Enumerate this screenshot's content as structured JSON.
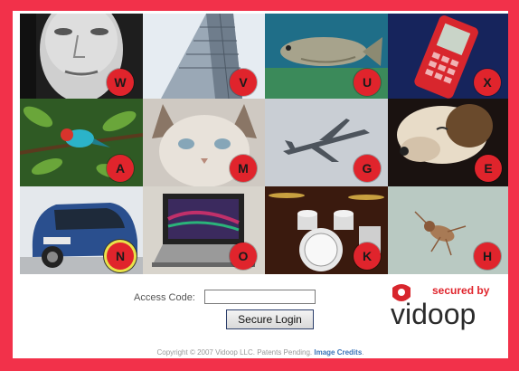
{
  "tiles": [
    {
      "letter": "W",
      "subject": "man-face"
    },
    {
      "letter": "V",
      "subject": "skyscraper"
    },
    {
      "letter": "U",
      "subject": "fish"
    },
    {
      "letter": "X",
      "subject": "red-phone"
    },
    {
      "letter": "A",
      "subject": "bird"
    },
    {
      "letter": "M",
      "subject": "cat"
    },
    {
      "letter": "G",
      "subject": "fighter-jet"
    },
    {
      "letter": "E",
      "subject": "dog"
    },
    {
      "letter": "N",
      "subject": "blue-car",
      "selected": true
    },
    {
      "letter": "O",
      "subject": "laptop"
    },
    {
      "letter": "K",
      "subject": "drum-kit"
    },
    {
      "letter": "H",
      "subject": "insect"
    }
  ],
  "login": {
    "access_code_label": "Access Code:",
    "access_code_value": "",
    "button_label": "Secure Login"
  },
  "logo": {
    "secured_by": "secured by",
    "wordmark": "vidoop"
  },
  "footer": {
    "copyright": "Copyright © 2007 Vidoop LLC. Patents Pending.",
    "credits_link": "Image Credits",
    "end": "."
  },
  "colors": {
    "frame": "#f2314a",
    "badge": "#e0242c",
    "link": "#3b74b8"
  }
}
